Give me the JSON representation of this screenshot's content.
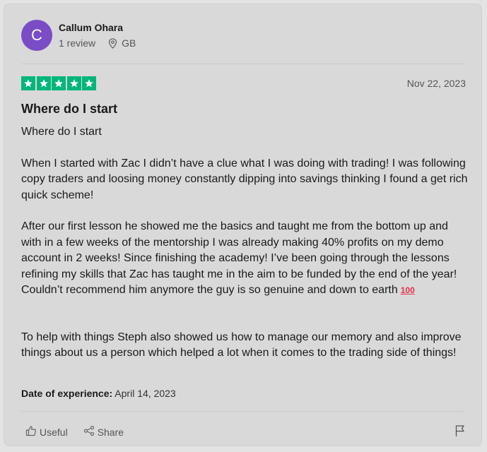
{
  "reviewer": {
    "avatar_letter": "C",
    "avatar_color": "#7a4cc6",
    "name": "Callum Ohara",
    "review_count": "1 review",
    "location": "GB"
  },
  "review": {
    "rating": 5,
    "star_color": "#00b67a",
    "date": "Nov 22, 2023",
    "title": "Where do I start",
    "paragraphs": [
      "Where do I start",
      "When I started with Zac I didn’t have a clue what I was doing with trading! I was following copy traders and loosing money constantly dipping into savings thinking I found a get rich quick scheme!",
      "After our first lesson he showed me the basics and taught me from the bottom up and with in a few weeks of the mentorship I was already making 40% profits on my demo account in 2 weeks! Since finishing the academy! I’ve been going through the lessons refining my skills that Zac has taught me in the aim to be funded by the end of the year! Couldn’t recommend him anymore the guy is so genuine and down to earth",
      "To help with things Steph also showed us how to manage our memory and also improve things about us a person which helped a lot when it comes to the trading side of things!"
    ],
    "emoji": "100",
    "experience_label": "Date of experience:",
    "experience_date": "April 14, 2023"
  },
  "actions": {
    "useful_label": "Useful",
    "share_label": "Share"
  }
}
